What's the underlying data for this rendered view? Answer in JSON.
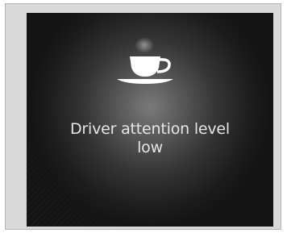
{
  "alert": {
    "icon": "coffee-cup-icon",
    "message_line1": "Driver attention level",
    "message_line2": "low"
  },
  "colors": {
    "frame_background": "#d9d9d9",
    "display_center": "#7a7a7a",
    "display_edge": "#141414",
    "text": "#e6e6e6",
    "icon": "#ffffff"
  }
}
